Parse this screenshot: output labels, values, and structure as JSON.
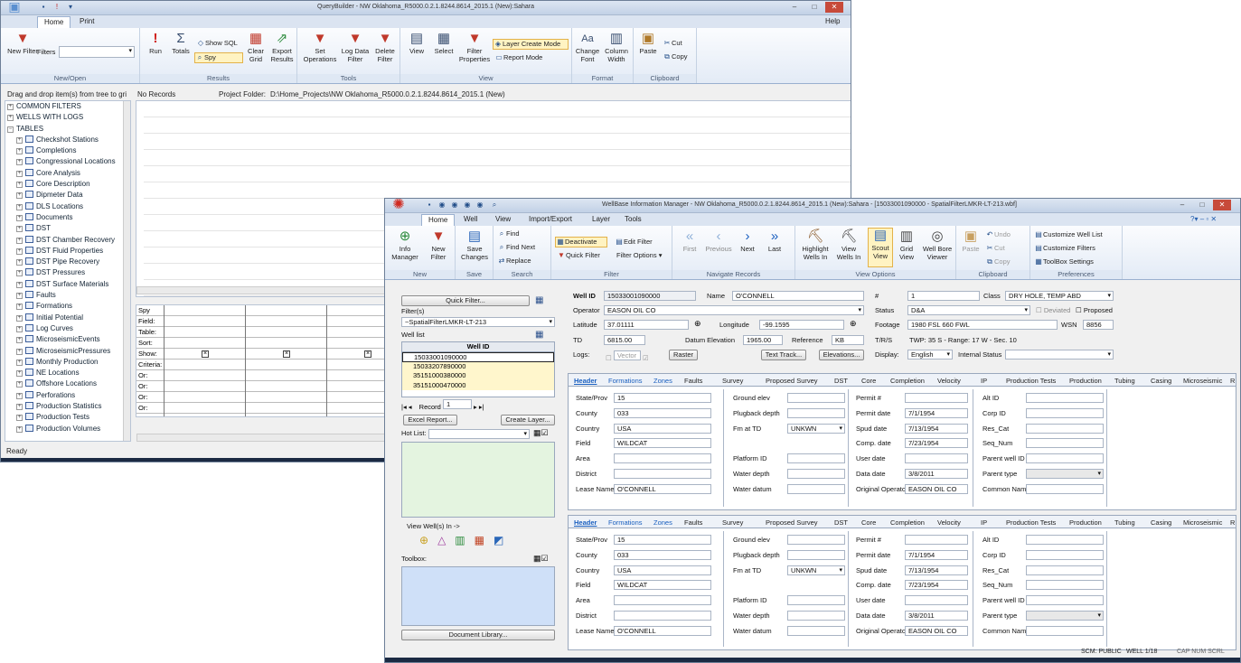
{
  "qb": {
    "title": "QueryBuilder - NW Oklahoma_R5000.0.2.1.8244.8614_2015.1 (New):Sahara",
    "tabs": [
      "Home",
      "Print"
    ],
    "help": "Help",
    "ribbon": {
      "new_filter": "New Filter",
      "filters_label": "Filters",
      "new_open": "New/Open",
      "run": "Run",
      "totals": "Totals",
      "show_sql": "Show SQL",
      "spy": "Spy",
      "clear_grid": "Clear Grid",
      "export_results": "Export Results",
      "results": "Results",
      "set_operations": "Set Operations",
      "log_data_filter": "Log Data Filter",
      "delete_filter": "Delete Filter",
      "tools": "Tools",
      "view": "View",
      "select": "Select",
      "filter_properties": "Filter Properties",
      "layer_create_mode": "Layer Create Mode",
      "report_mode": "Report Mode",
      "view_group": "View",
      "change_font": "Change Font",
      "column_width": "Column Width",
      "format": "Format",
      "paste": "Paste",
      "cut": "Cut",
      "copy": "Copy",
      "clipboard": "Clipboard"
    },
    "drag_hint": "Drag and drop item(s) from tree to gri",
    "no_records": "No Records",
    "project_folder_label": "Project Folder:",
    "project_folder": "D:\\Home_Projects\\NW Oklahoma_R5000.0.2.1.8244.8614_2015.1 (New)",
    "tree_top": [
      "COMMON FILTERS",
      "WELLS WITH LOGS",
      "TABLES"
    ],
    "tree_tables": [
      "Checkshot Stations",
      "Completions",
      "Congressional Locations",
      "Core Analysis",
      "Core Description",
      "Dipmeter Data",
      "DLS Locations",
      "Documents",
      "DST",
      "DST Chamber Recovery",
      "DST Fluid Properties",
      "DST Pipe Recovery",
      "DST Pressures",
      "DST Surface Materials",
      "Faults",
      "Formations",
      "Initial Potential",
      "Log Curves",
      "MicroseismicEvents",
      "MicroseismicPressures",
      "Monthly Production",
      "NE Locations",
      "Offshore Locations",
      "Perforations",
      "Production Statistics",
      "Production Tests",
      "Production Volumes"
    ],
    "criteria_rows": [
      "Spy",
      "Field:",
      "Table:",
      "Sort:",
      "Show:",
      "Criteria:",
      "Or:",
      "Or:",
      "Or:",
      "Or:",
      "Or:"
    ],
    "status": "Ready"
  },
  "wb": {
    "title": "WellBase Information Manager - NW Oklahoma_R5000.0.2.1.8244.8614_2015.1 (New):Sahara - [15033001090000 - SpatialFilterLMKR-LT-213.wbf]",
    "tabs": [
      "Home",
      "Well",
      "View",
      "Import/Export",
      "Layer",
      "Tools"
    ],
    "ribbon": {
      "info_manager": "Info Manager",
      "new_filter": "New Filter",
      "new": "New",
      "save_changes": "Save Changes",
      "save": "Save",
      "find": "Find",
      "find_next": "Find Next",
      "replace": "Replace",
      "search": "Search",
      "deactivate": "Deactivate",
      "quick_filter": "Quick Filter",
      "edit_filter": "Edit Filter",
      "filter_options": "Filter Options",
      "filter": "Filter",
      "first": "First",
      "previous": "Previous",
      "next": "Next",
      "last": "Last",
      "navigate": "Navigate Records",
      "highlight": "Highlight Wells In",
      "view_wells": "View Wells In",
      "scout_view": "Scout View",
      "grid_view": "Grid View",
      "well_bore": "Well Bore Viewer",
      "view_options": "View Options",
      "paste": "Paste",
      "undo": "Undo",
      "cut": "Cut",
      "copy": "Copy",
      "clipboard": "Clipboard",
      "customize_well_list": "Customize Well List",
      "customize_filters": "Customize Filters",
      "toolbox_settings": "ToolBox Settings",
      "preferences": "Preferences"
    },
    "left": {
      "quick_filter_btn": "Quick Filter...",
      "filters_label": "Filter(s)",
      "filter_value": "~SpatialFilterLMKR-LT-213",
      "well_list_label": "Well list",
      "well_id_col": "Well ID",
      "wells": [
        "15033001090000",
        "15033207890000",
        "35151000380000",
        "35151000470000"
      ],
      "record_label": "Record",
      "record_value": "1",
      "excel_report": "Excel Report...",
      "create_layer": "Create Layer...",
      "hot_list": "Hot List:",
      "view_wells_in": "View Well(s) In ->",
      "toolbox": "Toolbox:",
      "document_library": "Document Library..."
    },
    "header": {
      "well_id_label": "Well ID",
      "well_id": "15033001090000",
      "name_label": "Name",
      "name": "O'CONNELL",
      "num_label": "#",
      "num": "1",
      "class_label": "Class",
      "class": "DRY HOLE, TEMP ABD",
      "operator_label": "Operator",
      "operator": "EASON OIL CO",
      "status_label": "Status",
      "status": "D&A",
      "deviated": "Deviated",
      "proposed": "Proposed",
      "lat_label": "Latitude",
      "lat": "37.01111",
      "lon_label": "Longitude",
      "lon": "-99.1595",
      "footage_label": "Footage",
      "footage": "1980 FSL 660 FWL",
      "wsn_label": "WSN",
      "wsn": "8856",
      "td_label": "TD",
      "td": "6815.00",
      "datum_label": "Datum Elevation",
      "datum": "1965.00",
      "ref_label": "Reference",
      "ref": "KB",
      "trs_label": "T/R/S",
      "trs": "TWP: 35  S - Range: 17 W - Sec. 10",
      "logs_label": "Logs:",
      "vector": "Vector",
      "raster": "Raster",
      "text_track": "Text Track...",
      "elevations": "Elevations...",
      "display_label": "Display:",
      "display": "English",
      "internal_status": "Internal Status"
    },
    "section_tabs": [
      "Header",
      "Formations",
      "Zones",
      "Faults",
      "Survey",
      "Proposed Survey",
      "DST",
      "Core",
      "Completion",
      "Velocity",
      "IP",
      "Production Tests",
      "Production",
      "Tubing",
      "Casing",
      "Microseismic",
      "R"
    ],
    "fields": {
      "c1": [
        [
          "State/Prov",
          "15"
        ],
        [
          "County",
          "033"
        ],
        [
          "Country",
          "USA"
        ],
        [
          "Field",
          "WILDCAT"
        ],
        [
          "Area",
          ""
        ],
        [
          "District",
          ""
        ],
        [
          "Lease Name",
          "O'CONNELL"
        ]
      ],
      "c2": [
        [
          "Ground elev",
          ""
        ],
        [
          "Plugback depth",
          ""
        ],
        [
          "Fm at TD",
          "UNKWN"
        ],
        [
          "",
          ""
        ],
        [
          "Platform ID",
          ""
        ],
        [
          "Water depth",
          ""
        ],
        [
          "Water datum",
          ""
        ]
      ],
      "c3": [
        [
          "Permit #",
          ""
        ],
        [
          "Permit date",
          "7/1/1954"
        ],
        [
          "Spud date",
          "7/13/1954"
        ],
        [
          "Comp. date",
          "7/23/1954"
        ],
        [
          "User date",
          ""
        ],
        [
          "Data date",
          "3/8/2011"
        ],
        [
          "Original Operator",
          "EASON OIL CO"
        ]
      ],
      "c4": [
        [
          "Alt ID",
          ""
        ],
        [
          "Corp ID",
          ""
        ],
        [
          "Res_Cat",
          ""
        ],
        [
          "Seq_Num",
          ""
        ],
        [
          "Parent well ID",
          ""
        ],
        [
          "Parent type",
          ""
        ],
        [
          "Common Name",
          ""
        ]
      ]
    },
    "status": {
      "scm": "SCM: PUBLIC",
      "well": "WELL  1/18",
      "caps": "CAP  NUM  SCRL"
    }
  }
}
